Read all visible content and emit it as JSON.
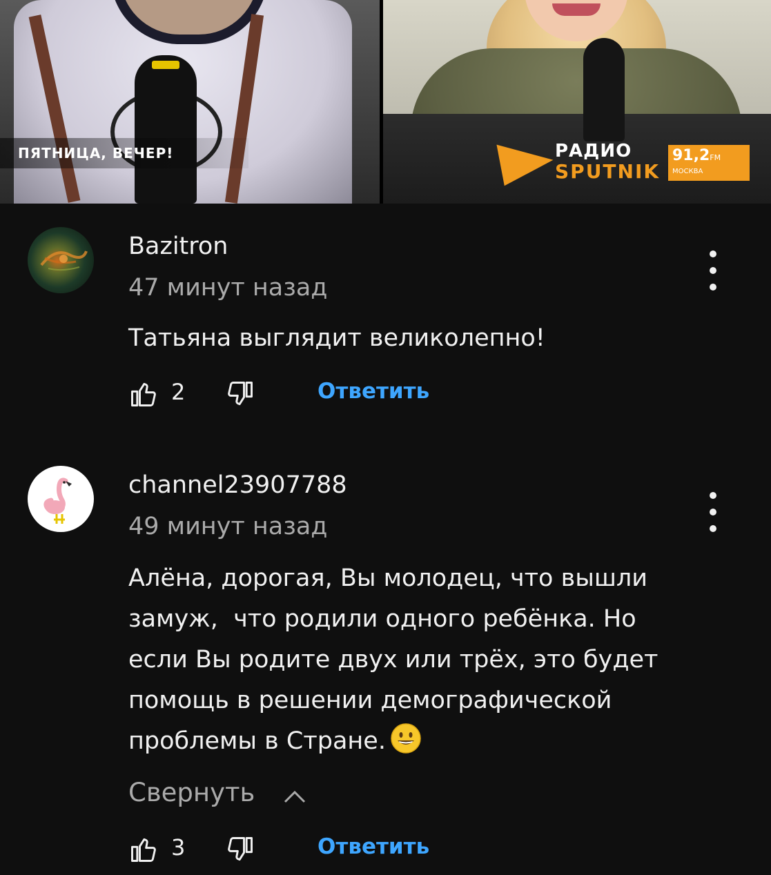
{
  "video": {
    "show_title": "ПЯТНИЦА, ВЕЧЕР!",
    "radio_name_line1": "РАДИО",
    "radio_name_line2": "SPUTNIK",
    "frequency": "91,2",
    "frequency_unit": "FM",
    "city": "МОСКВА",
    "accent_color": "#f29c1f"
  },
  "comments": [
    {
      "author": "Bazitron",
      "time": "47 минут назад",
      "text": "Татьяна выглядит великолепно!",
      "likes": "2",
      "reply_label": "Ответить",
      "avatar_icon": "nebula-avatar"
    },
    {
      "author": "channel23907788",
      "time": "49 минут назад",
      "text_lines": [
        "Алёна, дорогая, Вы молодец, что вышли",
        "замуж,  что родили одного ребёнка. Но",
        "если Вы родите двух или трёх, это будет",
        "помощь в решении демографической",
        "проблемы в Стране."
      ],
      "emoji": "grinning-face-emoji",
      "collapse_label": "Свернуть",
      "likes": "3",
      "reply_label": "Ответить",
      "avatar_icon": "flamingo-avatar"
    }
  ],
  "colors": {
    "background": "#0f0f0f",
    "primary_text": "#f1f1f1",
    "secondary_text": "#aaaaaa",
    "link": "#3ea6ff"
  }
}
